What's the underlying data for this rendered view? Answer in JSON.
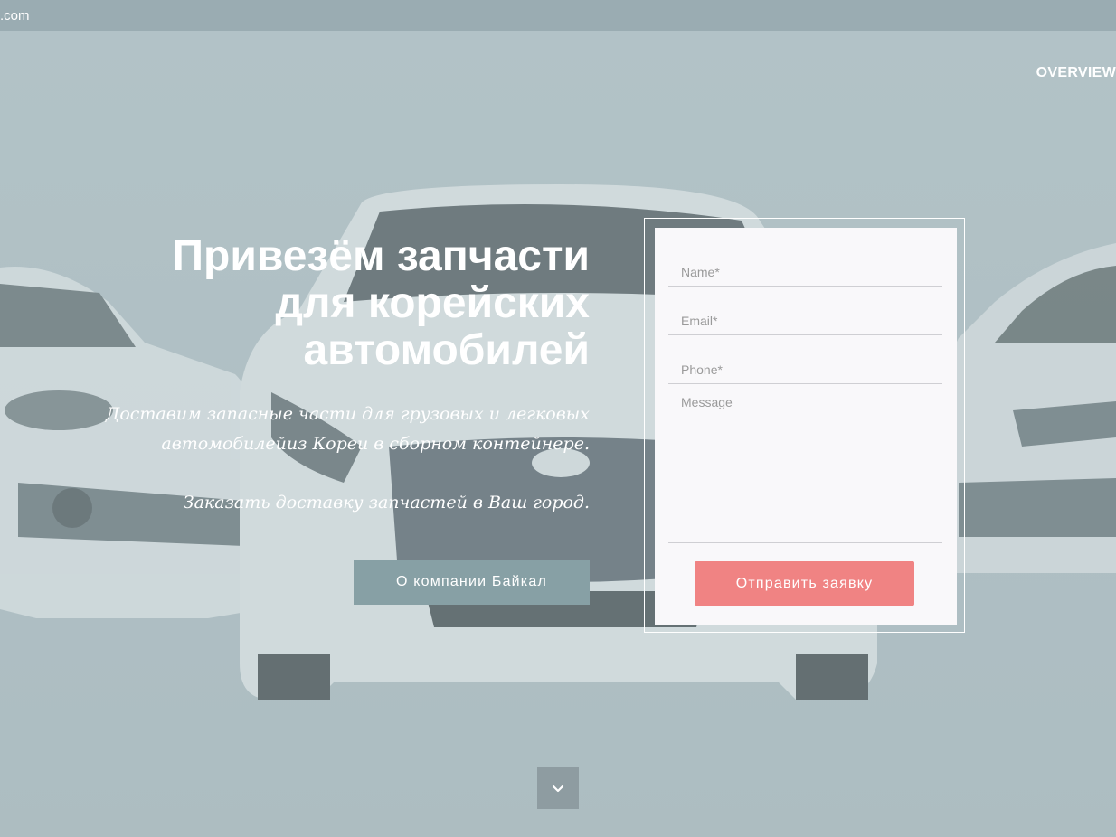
{
  "topbar": {
    "domain_fragment": ".com"
  },
  "nav": {
    "overview": "OVERVIEW"
  },
  "hero": {
    "title": "Привезём запчасти для корейских автомобилей",
    "subtitle_1": "Доставим запасные части для грузовых и легковых автомобилейиз Кореи в сборном контейнере.",
    "subtitle_2": "Заказать доставку запчастей в  Ваш город.",
    "about_button": "О компании Байкал"
  },
  "form": {
    "name_placeholder": "Name*",
    "email_placeholder": "Email*",
    "phone_placeholder": "Phone*",
    "message_placeholder": "Message",
    "submit_label": "Отправить заявку"
  },
  "icons": {
    "scroll_down": "chevron-down-icon"
  },
  "colors": {
    "accent_submit": "#f08383",
    "about_button": "#87a0a5",
    "hero_bg": "#b1c1c6"
  }
}
